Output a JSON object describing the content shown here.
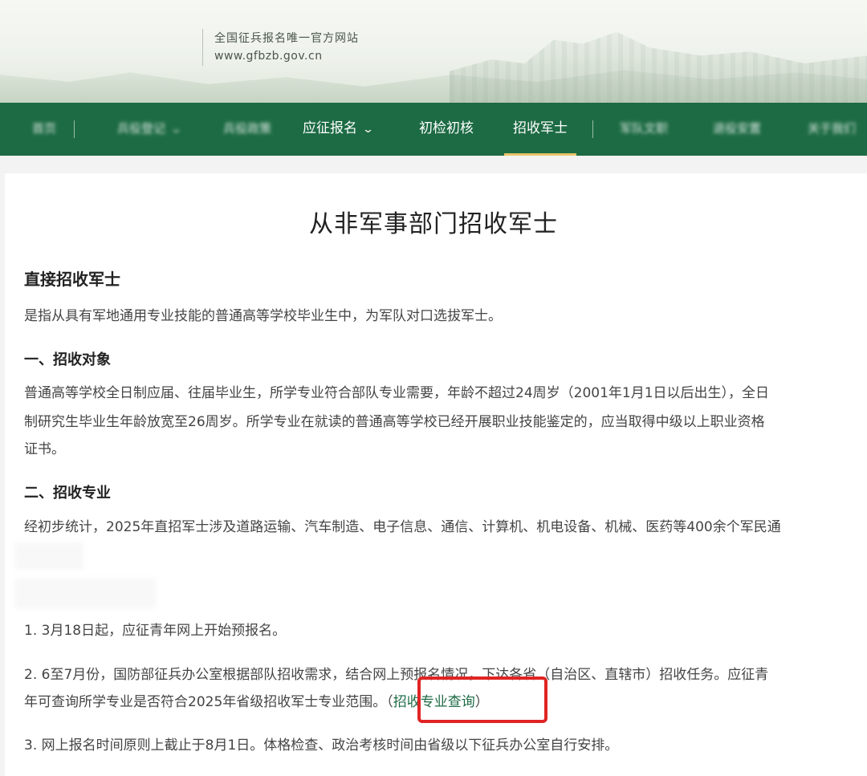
{
  "header": {
    "site_name": "全国征兵报名唯一官方网站",
    "site_url": "www.gfbzb.gov.cn"
  },
  "nav": {
    "items": [
      {
        "label": "首页",
        "blurred": true
      },
      {
        "label": "兵役登记",
        "blurred": true,
        "has_dropdown": true
      },
      {
        "label": "兵役政策",
        "blurred": true
      },
      {
        "label": "应征报名",
        "blurred": false,
        "has_dropdown": true
      },
      {
        "label": "初检初核",
        "blurred": false
      },
      {
        "label": "招收军士",
        "blurred": false,
        "active": true
      },
      {
        "label": "军队文职",
        "blurred": true
      },
      {
        "label": "退役安置",
        "blurred": true
      },
      {
        "label": "关于我们",
        "blurred": true
      }
    ],
    "active_color": "#e9c46a",
    "bar_color": "#1d6b44"
  },
  "article": {
    "title": "从非军事部门招收军士",
    "section_title": "直接招收军士",
    "intro": "是指从具有军地通用专业技能的普通高等学校毕业生中，为军队对口选拔军士。",
    "sub1_title": "一、招收对象",
    "sub1_line1": "普通高等学校全日制应届、往届毕业生，所学专业符合部队专业需要，年龄不超过24周岁（2001年1月1日以后出生），全日",
    "sub1_line2": "制研究生毕业生年龄放宽至26周岁。所学专业在就读的普通高等学校已经开展职业技能鉴定的，应当取得中级以上职业资格",
    "sub1_line3": "证书。",
    "sub2_title": "二、招收专业",
    "sub2_line1": "经初步统计，2025年直招军士涉及道路运输、汽车制造、电子信息、通信、计算机、机电设备、机械、医药等400余个军民通",
    "step1": "1. 3月18日起，应征青年网上开始预报名。",
    "step2_line1": "2. 6至7月份，国防部征兵办公室根据部队招收需求，结合网上预报名情况，下达各省（自治区、直辖市）招收任务。应征青",
    "step2_line2": "年可查询所学专业是否符合2025年省级招收军士专业范围。",
    "query_open": "（",
    "query_link": "招收专业查询",
    "query_close": "）",
    "step3": "3. 网上报名时间原则上截止于8月1日。体格检查、政治考核时间由省级以下征兵办公室自行安排。"
  }
}
